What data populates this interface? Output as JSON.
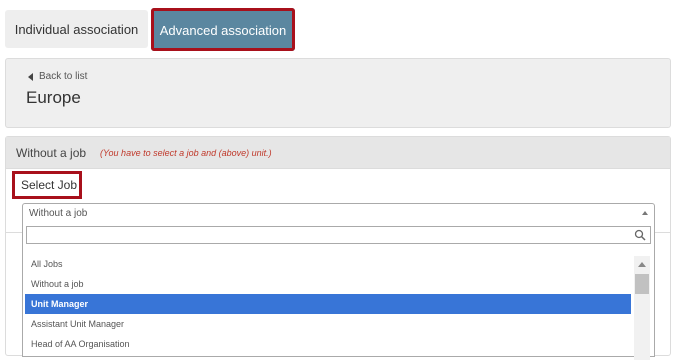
{
  "tabs": [
    {
      "label": "Individual association",
      "active": false
    },
    {
      "label": "Advanced association",
      "active": true
    }
  ],
  "header": {
    "back_label": "Back to list",
    "title": "Europe"
  },
  "section": {
    "title": "Without a job",
    "warning": "(You have to select a job and (above) unit.)"
  },
  "job_select": {
    "label": "Select Job",
    "selected_value": "Without a job",
    "search_value": "",
    "options": [
      {
        "label": "All Jobs",
        "selected": false
      },
      {
        "label": "Without a job",
        "selected": false
      },
      {
        "label": "Unit Manager",
        "selected": true
      },
      {
        "label": "Assistant Unit Manager",
        "selected": false
      },
      {
        "label": "Head of AA Organisation",
        "selected": false
      }
    ]
  },
  "colors": {
    "accent_tab": "#5b87a0",
    "highlight_border": "#a8101b",
    "selected_option": "#3875d7",
    "warning_text": "#c0392b"
  },
  "icons": {
    "back": "caret-left-icon",
    "search": "search-icon",
    "select_arrow": "caret-up-icon",
    "scroll_up": "scroll-up-arrow-icon"
  }
}
